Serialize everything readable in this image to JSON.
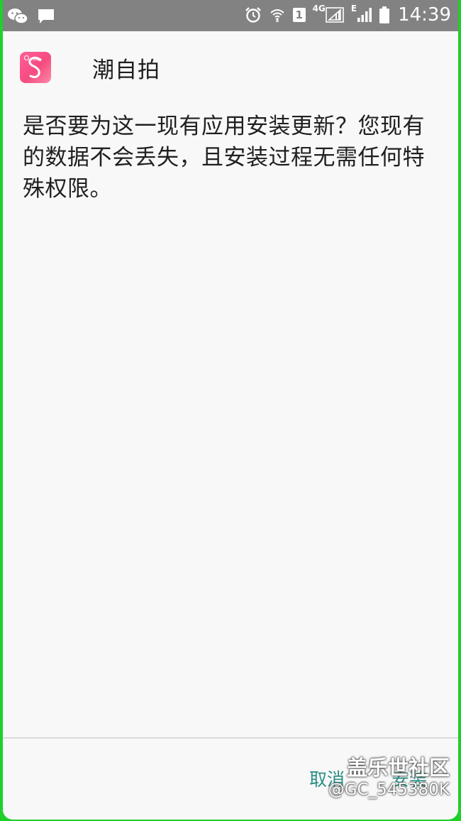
{
  "status_bar": {
    "time": "14:39",
    "sim_slot": "1",
    "network_4g": "4G",
    "network_e": "E",
    "left_icons": [
      "wechat-icon",
      "chat-bubble-icon"
    ],
    "right_icons": [
      "alarm-icon",
      "wifi-icon",
      "sim-icon",
      "signal-icon",
      "signal-icon",
      "battery-icon"
    ]
  },
  "dialog": {
    "app_name": "潮自拍",
    "app_icon_letter": "S",
    "app_icon_colors": [
      "#ff5f9a",
      "#f54c80"
    ],
    "message": "是否要为这一现有应用安装更新？您现有的数据不会丢失，且安装过程无需任何特殊权限。",
    "cancel_label": "取消",
    "install_label": "安装",
    "button_color": "#2a8f86"
  },
  "watermark": {
    "line1": "盖乐世社区",
    "line2": "@GC_545380K"
  }
}
